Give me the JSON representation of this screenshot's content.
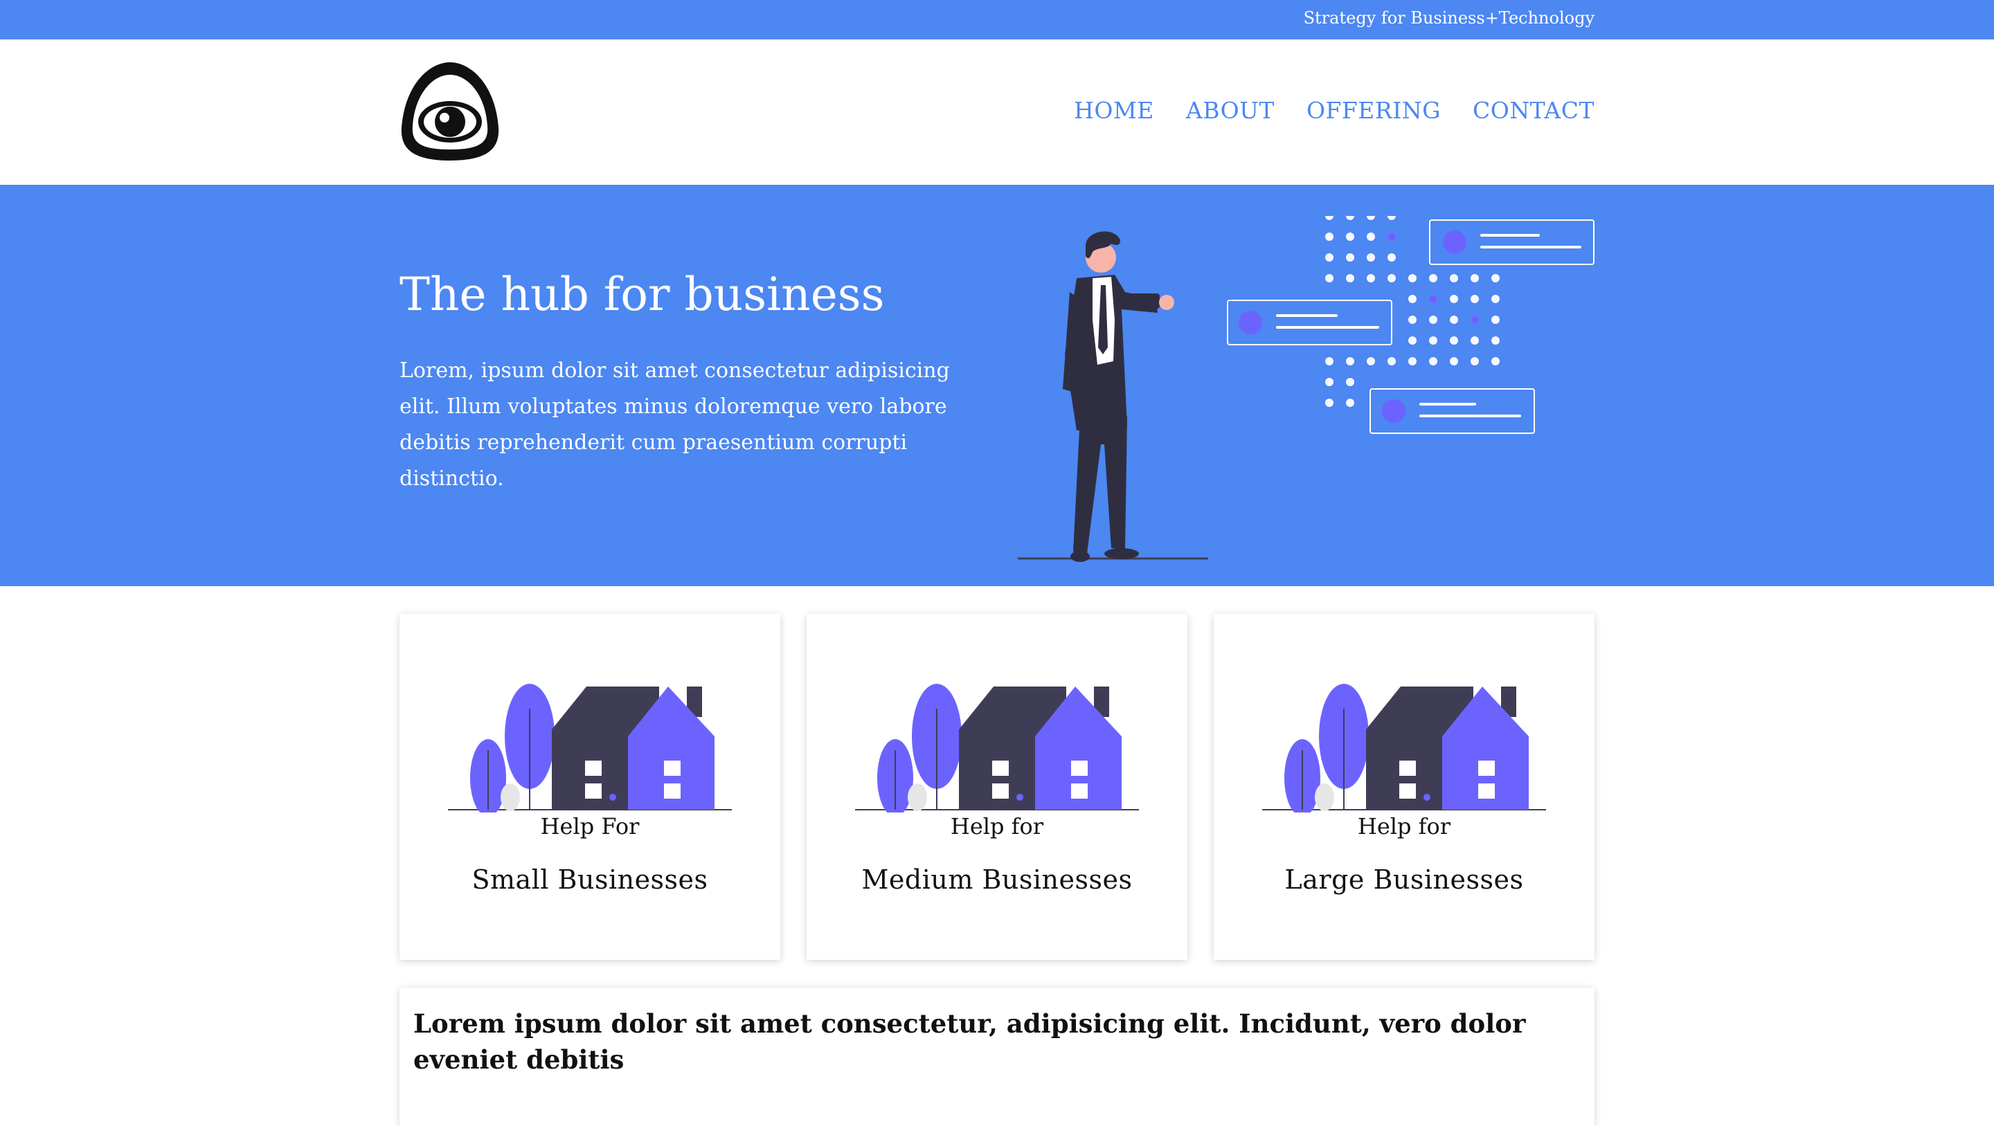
{
  "topbar": {
    "tagline": "Strategy for Business+Technology"
  },
  "header": {
    "logo_icon": "eye-triangle-logo-icon",
    "nav": [
      {
        "label": "HOME"
      },
      {
        "label": "ABOUT"
      },
      {
        "label": "OFFERING"
      },
      {
        "label": "CONTACT"
      }
    ]
  },
  "hero": {
    "title": "The hub for business",
    "body": "Lorem, ipsum dolor sit amet consectetur adipisicing elit. Illum voluptates minus doloremque vero labore debitis reprehenderit cum praesentium corrupti distinctio.",
    "illustration_icon": "businessman-presenting-illustration"
  },
  "cards": [
    {
      "subtitle": "Help For",
      "title": "Small Businesses",
      "icon": "house-trees-illustration"
    },
    {
      "subtitle": "Help for",
      "title": "Medium Businesses",
      "icon": "house-trees-illustration"
    },
    {
      "subtitle": "Help for",
      "title": "Large Businesses",
      "icon": "house-trees-illustration"
    }
  ],
  "lower": {
    "text": "Lorem ipsum dolor sit amet consectetur, adipisicing elit. Incidunt, vero dolor eveniet debitis"
  },
  "colors": {
    "brand_blue": "#4c87f2",
    "accent_purple": "#6c63ff",
    "dark": "#3f3d56"
  }
}
